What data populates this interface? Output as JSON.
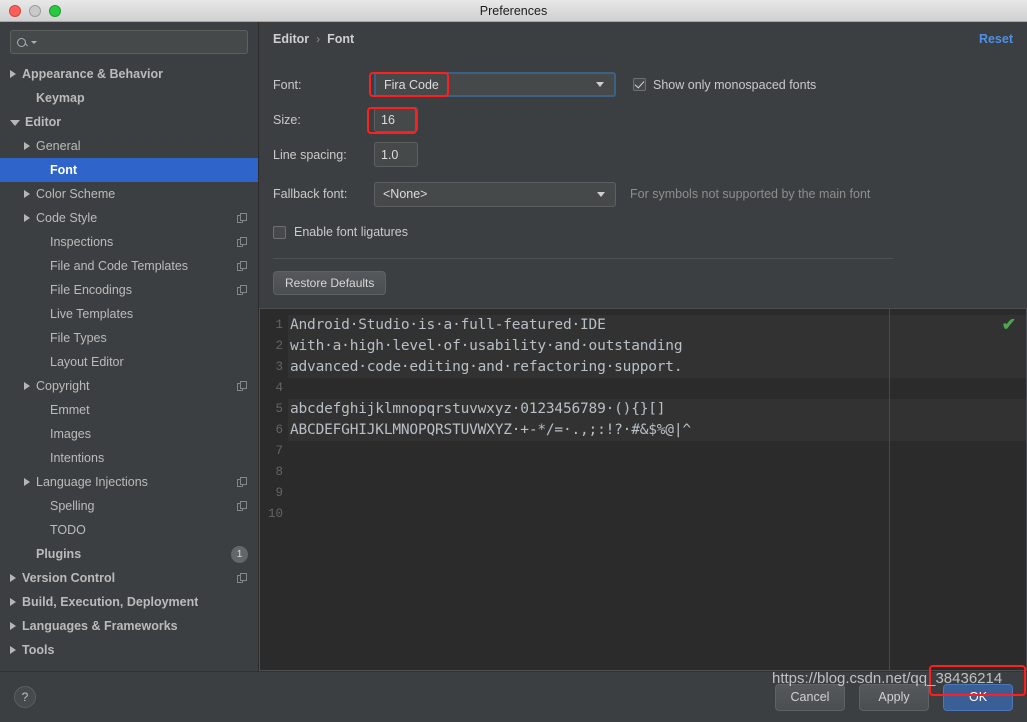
{
  "window": {
    "title": "Preferences",
    "traffic_lights": [
      "close-red",
      "minimize-gray",
      "zoom-green"
    ]
  },
  "sidebar": {
    "search": {
      "value": "",
      "placeholder": ""
    },
    "items": [
      {
        "label": "Appearance & Behavior",
        "indent": 0,
        "arrow": "closed",
        "bold": true,
        "selected": false,
        "copy": false
      },
      {
        "label": "Keymap",
        "indent": 1,
        "arrow": "none",
        "bold": true,
        "selected": false,
        "copy": false
      },
      {
        "label": "Editor",
        "indent": 0,
        "arrow": "open",
        "bold": true,
        "selected": false,
        "copy": false
      },
      {
        "label": "General",
        "indent": 1,
        "arrow": "closed",
        "bold": false,
        "selected": false,
        "copy": false
      },
      {
        "label": "Font",
        "indent": 2,
        "arrow": "none",
        "bold": true,
        "selected": true,
        "copy": false
      },
      {
        "label": "Color Scheme",
        "indent": 1,
        "arrow": "closed",
        "bold": false,
        "selected": false,
        "copy": false
      },
      {
        "label": "Code Style",
        "indent": 1,
        "arrow": "closed",
        "bold": false,
        "selected": false,
        "copy": true
      },
      {
        "label": "Inspections",
        "indent": 2,
        "arrow": "none",
        "bold": false,
        "selected": false,
        "copy": true
      },
      {
        "label": "File and Code Templates",
        "indent": 2,
        "arrow": "none",
        "bold": false,
        "selected": false,
        "copy": true
      },
      {
        "label": "File Encodings",
        "indent": 2,
        "arrow": "none",
        "bold": false,
        "selected": false,
        "copy": true
      },
      {
        "label": "Live Templates",
        "indent": 2,
        "arrow": "none",
        "bold": false,
        "selected": false,
        "copy": false
      },
      {
        "label": "File Types",
        "indent": 2,
        "arrow": "none",
        "bold": false,
        "selected": false,
        "copy": false
      },
      {
        "label": "Layout Editor",
        "indent": 2,
        "arrow": "none",
        "bold": false,
        "selected": false,
        "copy": false
      },
      {
        "label": "Copyright",
        "indent": 1,
        "arrow": "closed",
        "bold": false,
        "selected": false,
        "copy": true
      },
      {
        "label": "Emmet",
        "indent": 2,
        "arrow": "none",
        "bold": false,
        "selected": false,
        "copy": false
      },
      {
        "label": "Images",
        "indent": 2,
        "arrow": "none",
        "bold": false,
        "selected": false,
        "copy": false
      },
      {
        "label": "Intentions",
        "indent": 2,
        "arrow": "none",
        "bold": false,
        "selected": false,
        "copy": false
      },
      {
        "label": "Language Injections",
        "indent": 1,
        "arrow": "closed",
        "bold": false,
        "selected": false,
        "copy": true
      },
      {
        "label": "Spelling",
        "indent": 2,
        "arrow": "none",
        "bold": false,
        "selected": false,
        "copy": true
      },
      {
        "label": "TODO",
        "indent": 2,
        "arrow": "none",
        "bold": false,
        "selected": false,
        "copy": false
      },
      {
        "label": "Plugins",
        "indent": 1,
        "arrow": "none",
        "bold": true,
        "selected": false,
        "copy": false,
        "badge": "1"
      },
      {
        "label": "Version Control",
        "indent": 0,
        "arrow": "closed",
        "bold": true,
        "selected": false,
        "copy": true
      },
      {
        "label": "Build, Execution, Deployment",
        "indent": 0,
        "arrow": "closed",
        "bold": true,
        "selected": false,
        "copy": false
      },
      {
        "label": "Languages & Frameworks",
        "indent": 0,
        "arrow": "closed",
        "bold": true,
        "selected": false,
        "copy": false
      },
      {
        "label": "Tools",
        "indent": 0,
        "arrow": "closed",
        "bold": true,
        "selected": false,
        "copy": false
      }
    ]
  },
  "breadcrumb": {
    "parent": "Editor",
    "separator": "›",
    "current": "Font",
    "reset_label": "Reset"
  },
  "form": {
    "font_label": "Font:",
    "font_value": "Fira Code",
    "monospaced_label": "Show only monospaced fonts",
    "monospaced_checked": true,
    "size_label": "Size:",
    "size_value": "16",
    "line_spacing_label": "Line spacing:",
    "line_spacing_value": "1.0",
    "fallback_label": "Fallback font:",
    "fallback_value": "<None>",
    "fallback_hint": "For symbols not supported by the main font",
    "ligatures_label": "Enable font ligatures",
    "ligatures_checked": false,
    "restore_defaults_label": "Restore Defaults"
  },
  "preview": {
    "line_numbers": [
      "1",
      "2",
      "3",
      "4",
      "5",
      "6",
      "7",
      "8",
      "9",
      "10"
    ],
    "lines": [
      {
        "text": "Android·Studio·is·a·full-featured·IDE",
        "highlight": true
      },
      {
        "text": "with·a·high·level·of·usability·and·outstanding",
        "highlight": true
      },
      {
        "text": "advanced·code·editing·and·refactoring·support.",
        "highlight": true
      },
      {
        "text": "",
        "highlight": false
      },
      {
        "text": "abcdefghijklmnopqrstuvwxyz·0123456789·(){}[]",
        "highlight": true
      },
      {
        "text": "ABCDEFGHIJKLMNOPQRSTUVWXYZ·+-*/=·.,;:!?·#&$%@|^",
        "highlight": true
      },
      {
        "text": "",
        "highlight": false
      },
      {
        "text": "",
        "highlight": false
      },
      {
        "text": "",
        "highlight": false
      },
      {
        "text": "",
        "highlight": false
      }
    ],
    "status_icon": "✔"
  },
  "footer": {
    "help_label": "?",
    "cancel_label": "Cancel",
    "apply_label": "Apply",
    "ok_label": "OK"
  },
  "watermark": {
    "text": "https://blog.csdn.net/qq_38436214"
  },
  "colors": {
    "selection_blue": "#2f65ca",
    "accent_link": "#4e8fe8",
    "annotation_red": "#ff1f1f",
    "ok_button_blue": "#3a5e96",
    "preview_bg": "#2b2b2b",
    "panel_bg": "#3c3f41",
    "status_green": "#4fa64f"
  }
}
